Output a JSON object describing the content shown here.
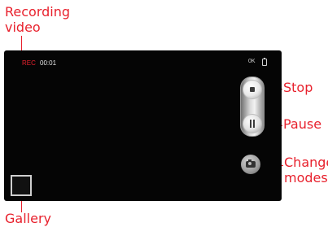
{
  "callouts": {
    "recording": [
      "Recording",
      "video"
    ],
    "stop": "Stop",
    "pause": "Pause",
    "change_modes": [
      "Change",
      "modes"
    ],
    "gallery": "Gallery"
  },
  "status": {
    "rec_label": "REC",
    "rec_time": "00:01",
    "storage_label": "0K"
  },
  "icons": {
    "battery": "battery-icon",
    "stop": "stop-icon",
    "pause": "pause-icon",
    "mode": "camera-icon"
  },
  "colors": {
    "callout": "#e8212d",
    "screen": "#050505"
  }
}
